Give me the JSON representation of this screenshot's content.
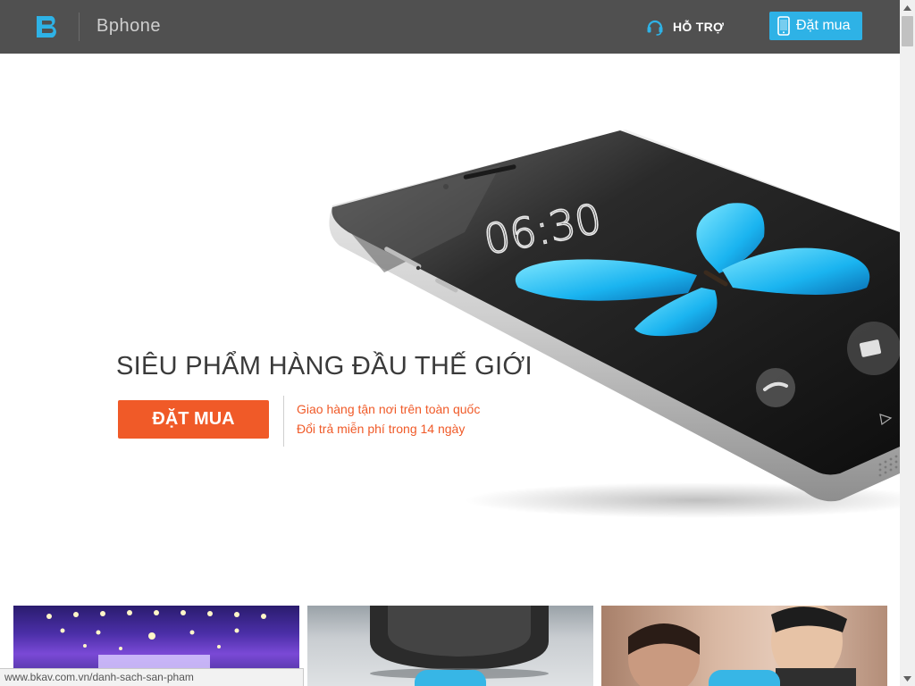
{
  "header": {
    "brand": "Bphone",
    "support_label": "HỖ TRỢ",
    "order_label": "Đặt mua"
  },
  "hero": {
    "tagline": "SIÊU PHẨM HÀNG ĐẦU THẾ GIỚI",
    "cta_label": "ĐẶT MUA",
    "perks": [
      "Giao hàng tận nơi trên toàn quốc",
      "Đổi trả miễn phí trong 14 ngày"
    ],
    "phone_clock": "06:30"
  },
  "status": {
    "url": "www.bkav.com.vn/danh-sach-san-pham"
  },
  "colors": {
    "header_bg": "#505050",
    "accent_blue": "#2eb2e6",
    "accent_orange": "#f05a28"
  },
  "icons": {
    "logo": "bphone-logo-icon",
    "support": "headset-icon",
    "order": "phone-icon"
  }
}
